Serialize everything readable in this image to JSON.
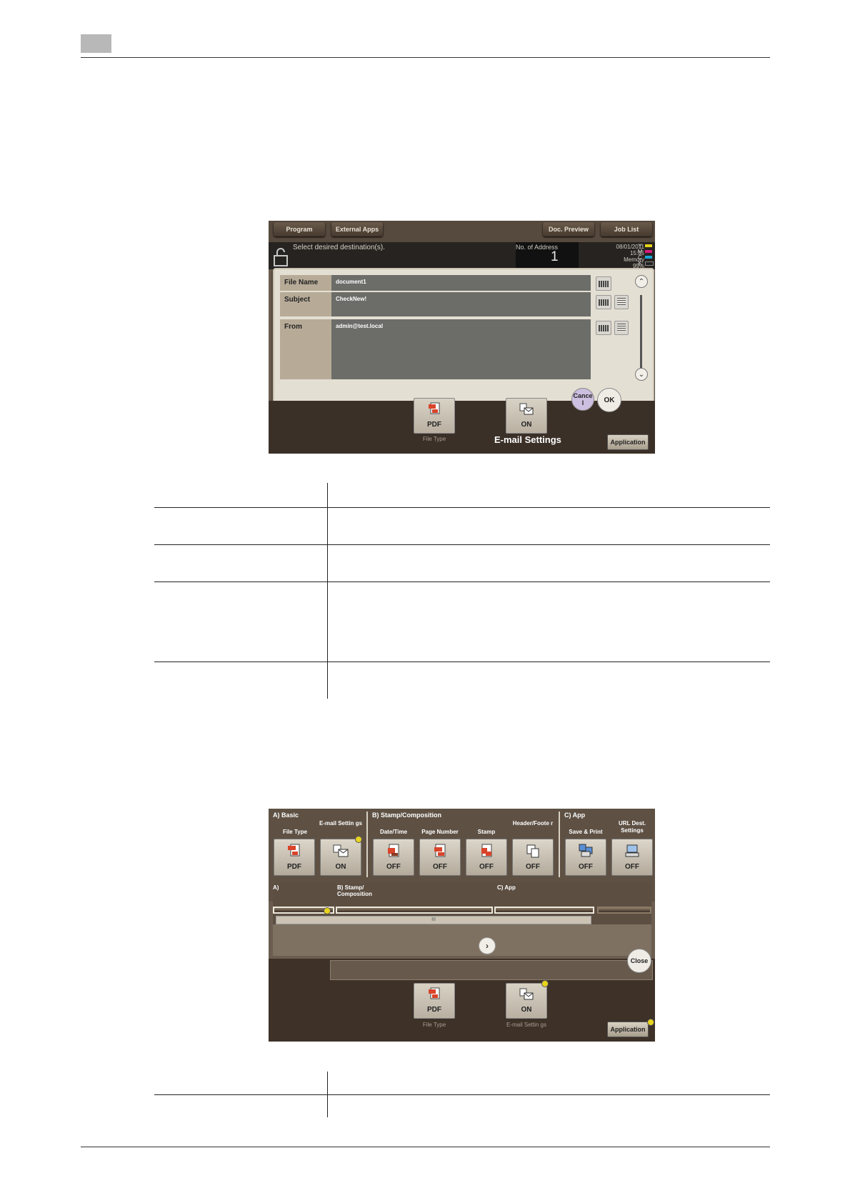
{
  "shot1": {
    "tabs": [
      "Program",
      "External Apps",
      "Doc. Preview",
      "Job List"
    ],
    "message": "Select desired destination(s).",
    "address_label": "No. of Address",
    "address_count": "1",
    "datetime": "08/01/2011",
    "time": "15:35",
    "memory_label": "Memory",
    "memory_value": "99%",
    "toner_labels": [
      "Y",
      "M",
      "C",
      "K"
    ],
    "fields": [
      {
        "label": "File Name",
        "value": "document1"
      },
      {
        "label": "Subject",
        "value": "CheckNew!"
      },
      {
        "label": "From",
        "value": "admin@test.local"
      }
    ],
    "cancel_label": "Cance l",
    "ok_label": "OK",
    "tiles": [
      {
        "value": "PDF",
        "caption": "File Type",
        "icon": "pdf-icon"
      },
      {
        "value": "ON",
        "caption": "E-mail Settings",
        "icon": "email-settings-icon"
      }
    ],
    "application_label": "Application"
  },
  "shot2": {
    "groups": [
      {
        "label": "A)  Basic"
      },
      {
        "label": "B)  Stamp/Composition"
      },
      {
        "label": "C)  App"
      }
    ],
    "columns": [
      {
        "label": "File Type",
        "value": "PDF",
        "icon": "pdf-icon"
      },
      {
        "label": "E-mail Settin gs",
        "value": "ON",
        "icon": "email-settings-icon"
      },
      {
        "label": "Date/Time",
        "value": "OFF",
        "icon": "date-time-icon"
      },
      {
        "label": "Page Number",
        "value": "OFF",
        "icon": "page-number-icon"
      },
      {
        "label": "Stamp",
        "value": "OFF",
        "icon": "stamp-icon"
      },
      {
        "label": "Header/Foote r",
        "value": "OFF",
        "icon": "header-footer-icon"
      },
      {
        "label": "Save & Print",
        "value": "OFF",
        "icon": "save-print-icon"
      },
      {
        "label": "URL Dest. Settings",
        "value": "OFF",
        "icon": "url-dest-icon"
      }
    ],
    "nav_labels": [
      "A)",
      "B) Stamp/ Composition",
      "C) App"
    ],
    "scroll_mark": "III",
    "close_label": "Close",
    "tiles": [
      {
        "value": "PDF",
        "caption": "File Type",
        "icon": "pdf-icon"
      },
      {
        "value": "ON",
        "caption": "E-mail Settin gs",
        "icon": "email-settings-icon"
      }
    ],
    "application_label": "Application"
  },
  "colors": {
    "panel": "#6b5d4f",
    "dark": "#3b3028",
    "indicator": "#e8d41e"
  }
}
